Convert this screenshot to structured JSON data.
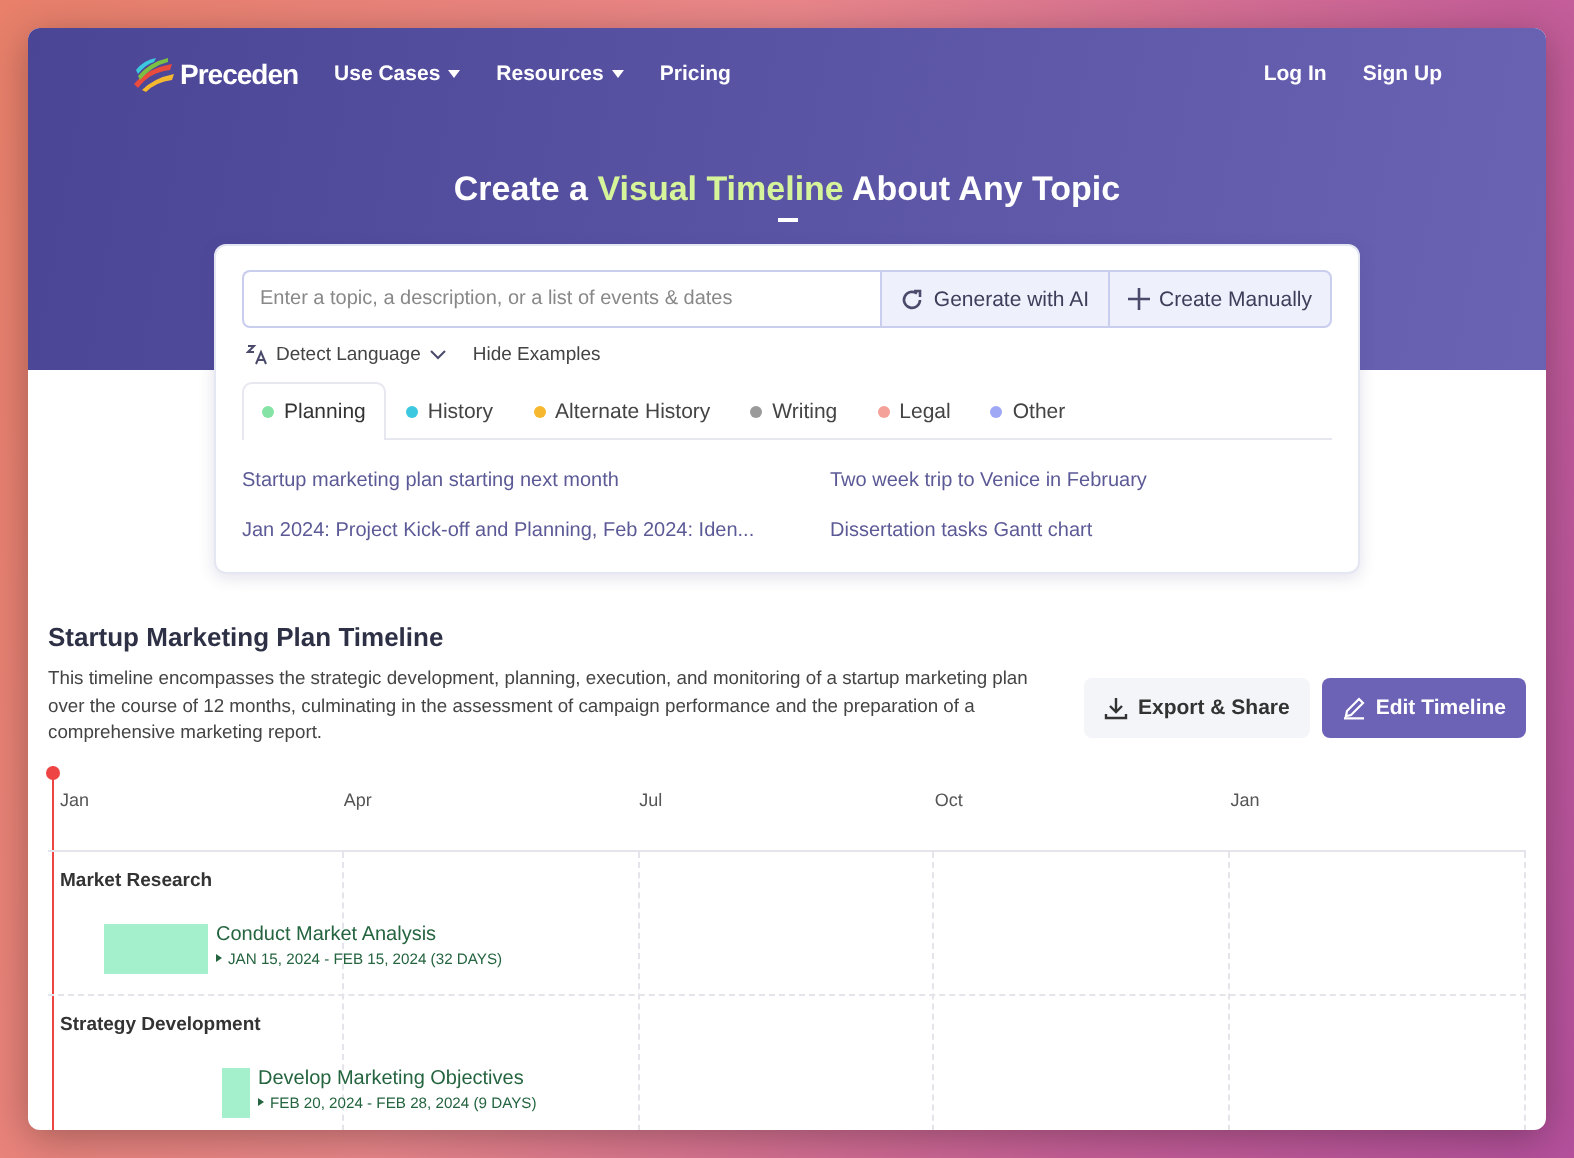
{
  "nav": {
    "logo": "Preceden",
    "menu": [
      {
        "label": "Use Cases",
        "dropdown": true
      },
      {
        "label": "Resources",
        "dropdown": true
      },
      {
        "label": "Pricing",
        "dropdown": false
      }
    ],
    "auth": [
      "Log In",
      "Sign Up"
    ]
  },
  "hero": {
    "title_before": "Create a ",
    "title_highlight": "Visual Timeline",
    "title_after": " About Any Topic"
  },
  "search": {
    "placeholder": "Enter a topic, a description, or a list of events & dates",
    "buttons": [
      {
        "label": "Generate with AI",
        "kind": "ai"
      },
      {
        "label": "Create Manually",
        "kind": "manual"
      }
    ]
  },
  "options": {
    "language": "Detect Language",
    "toggle": "Hide Examples"
  },
  "tabs": [
    {
      "label": "Planning",
      "color": "#86e3a6",
      "selected": true
    },
    {
      "label": "History",
      "color": "#3cc9e0",
      "selected": false
    },
    {
      "label": "Alternate History",
      "color": "#f5b82e",
      "selected": false
    },
    {
      "label": "Writing",
      "color": "#9a9a9a",
      "selected": false
    },
    {
      "label": "Legal",
      "color": "#f4a19a",
      "selected": false
    },
    {
      "label": "Other",
      "color": "#9fa8f5",
      "selected": false
    }
  ],
  "examples": [
    "Startup marketing plan starting next month",
    "Two week trip to Venice in February",
    "Jan 2024: Project Kick-off and Planning, Feb 2024: Iden...",
    "Dissertation tasks Gantt chart"
  ],
  "timeline": {
    "title": "Startup Marketing Plan Timeline",
    "description": "This timeline encompasses the strategic development, planning, execution, and monitoring of a startup marketing plan over the course of 12 months, culminating in the assessment of campaign performance and the preparation of a comprehensive marketing report.",
    "actions": [
      {
        "label": "Export & Share",
        "kind": "secondary"
      },
      {
        "label": "Edit Timeline",
        "kind": "primary"
      }
    ],
    "axis": [
      "Jan",
      "Apr",
      "Jul",
      "Oct",
      "Jan"
    ],
    "groups": [
      {
        "name": "Market Research",
        "events": [
          {
            "name": "Conduct Market Analysis",
            "dates": "JAN 15, 2024 - FEB 15, 2024 (32 DAYS)"
          }
        ]
      },
      {
        "name": "Strategy Development",
        "events": [
          {
            "name": "Develop Marketing Objectives",
            "dates": "FEB 20, 2024 - FEB 28, 2024 (9 DAYS)"
          }
        ]
      }
    ]
  }
}
